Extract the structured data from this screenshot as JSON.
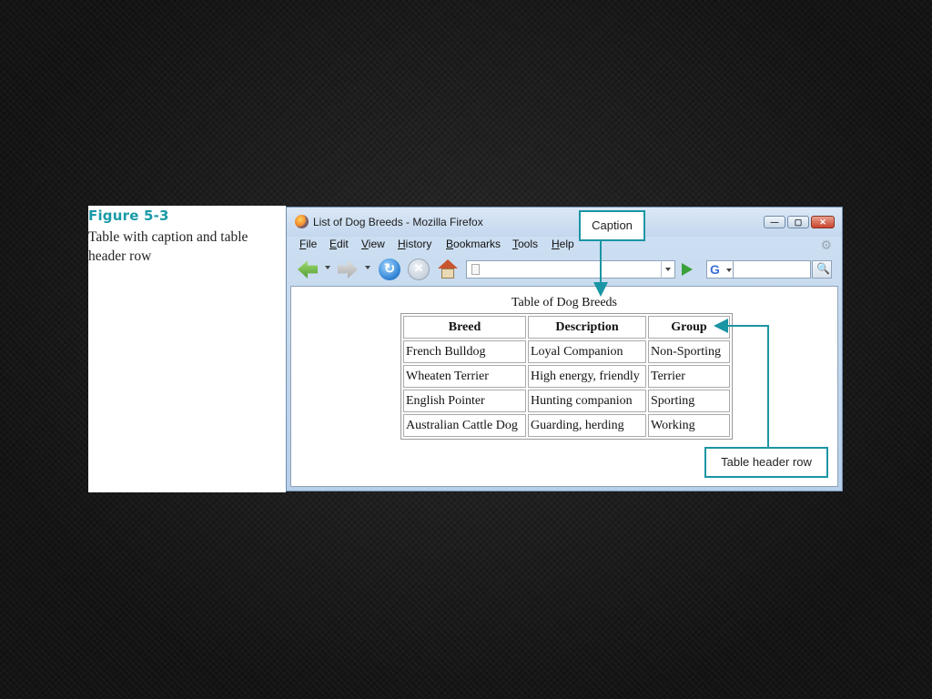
{
  "figure": {
    "number": "Figure 5-3",
    "caption": "Table with caption and table header row"
  },
  "window": {
    "title": "List of Dog Breeds - Mozilla Firefox",
    "buttons": {
      "minimize": "—",
      "maximize": "▢",
      "close": "✕"
    }
  },
  "menu": [
    {
      "u": "F",
      "rest": "ile"
    },
    {
      "u": "E",
      "rest": "dit"
    },
    {
      "u": "V",
      "rest": "iew"
    },
    {
      "u": "H",
      "rest": "istory"
    },
    {
      "u": "B",
      "rest": "ookmarks"
    },
    {
      "u": "T",
      "rest": "ools"
    },
    {
      "u": "H",
      "rest": "elp"
    }
  ],
  "toolbar": {
    "url_value": "",
    "search_engine_icon": "G",
    "search_value": ""
  },
  "page": {
    "caption": "Table of Dog Breeds",
    "headers": [
      "Breed",
      "Description",
      "Group"
    ],
    "rows": [
      [
        "French Bulldog",
        "Loyal Companion",
        "Non-Sporting"
      ],
      [
        "Wheaten Terrier",
        "High energy, friendly",
        "Terrier"
      ],
      [
        "English Pointer",
        "Hunting companion",
        "Sporting"
      ],
      [
        "Australian Cattle Dog",
        "Guarding, herding",
        "Working"
      ]
    ]
  },
  "callouts": {
    "caption": "Caption",
    "header_row": "Table header row"
  },
  "colors": {
    "accent": "#1a95a3",
    "figure_title": "#1a9aa7",
    "window_frame": "#b7cfe9"
  }
}
